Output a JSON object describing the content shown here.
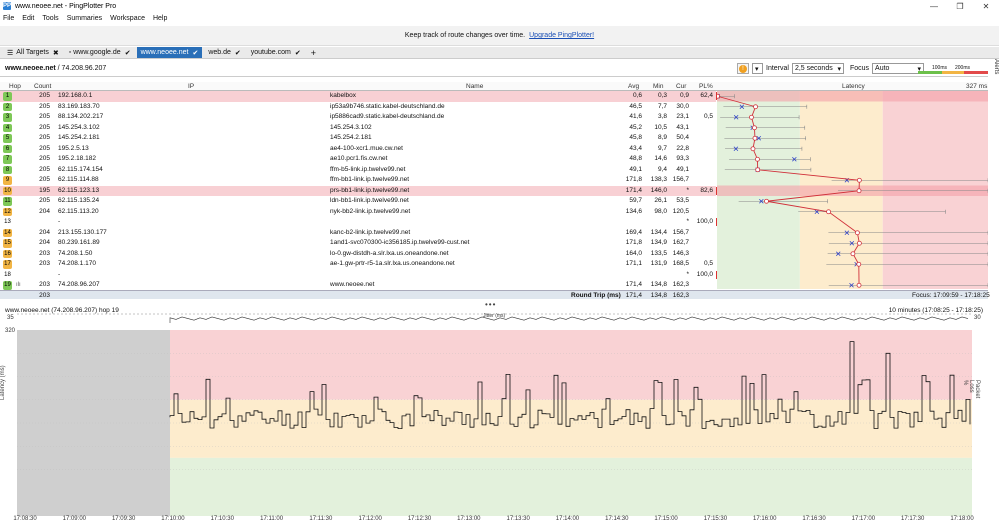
{
  "window": {
    "title": "www.neoee.net - PingPlotter Pro",
    "app_icon": "PP"
  },
  "menu": [
    "File",
    "Edit",
    "Tools",
    "Summaries",
    "Workspace",
    "Help"
  ],
  "promo": {
    "text": "Keep track of route changes over time.",
    "link": "Upgrade PingPlotter!"
  },
  "tabs": [
    {
      "label": "All Targets",
      "active": false,
      "mark": "✖"
    },
    {
      "label": "www.google.de",
      "active": false,
      "mark": "✔"
    },
    {
      "label": "www.neoee.net",
      "active": true,
      "mark": "✔"
    },
    {
      "label": "web.de",
      "active": false,
      "mark": "✔"
    },
    {
      "label": "youtube.com",
      "active": false,
      "mark": "✔"
    }
  ],
  "add_tab": "+",
  "target": {
    "host": "www.neoee.net",
    "ip": "/ 74.208.96.207"
  },
  "controls": {
    "interval_label": "Interval",
    "interval_value": "2,5 seconds",
    "focus_label": "Focus",
    "focus_value": "Auto"
  },
  "scale": {
    "low": "100ms",
    "high": "200ms"
  },
  "alerts_label": "Alerts",
  "grid_headers": {
    "hop": "Hop",
    "count": "Count",
    "ip": "IP",
    "name": "Name",
    "avg": "Avg",
    "min": "Min",
    "cur": "Cur",
    "pl": "PL%",
    "latency": "Latency",
    "max": "327 ms"
  },
  "hops": [
    {
      "hop": "1",
      "count": "205",
      "ip": "192.168.0.1",
      "name": "kabelbox",
      "avg": "0,6",
      "min": "0,3",
      "cur": "0,9",
      "pl": "62,4",
      "color": "#7ec857",
      "hl": true
    },
    {
      "hop": "2",
      "count": "205",
      "ip": "83.169.183.70",
      "name": "ip53a9b746.static.kabel-deutschland.de",
      "avg": "46,5",
      "min": "7,7",
      "cur": "30,0",
      "pl": "",
      "color": "#7ec857",
      "hl": false
    },
    {
      "hop": "3",
      "count": "205",
      "ip": "88.134.202.217",
      "name": "ip5886cad9.static.kabel-deutschland.de",
      "avg": "41,6",
      "min": "3,8",
      "cur": "23,1",
      "pl": "0,5",
      "color": "#7ec857",
      "hl": false
    },
    {
      "hop": "4",
      "count": "205",
      "ip": "145.254.3.102",
      "name": "145.254.3.102",
      "avg": "45,2",
      "min": "10,5",
      "cur": "43,1",
      "pl": "",
      "color": "#7ec857",
      "hl": false
    },
    {
      "hop": "5",
      "count": "205",
      "ip": "145.254.2.181",
      "name": "145.254.2.181",
      "avg": "45,8",
      "min": "8,9",
      "cur": "50,4",
      "pl": "",
      "color": "#7ec857",
      "hl": false
    },
    {
      "hop": "6",
      "count": "205",
      "ip": "195.2.5.13",
      "name": "ae4-100-xcr1.mue.cw.net",
      "avg": "43,4",
      "min": "9,7",
      "cur": "22,8",
      "pl": "",
      "color": "#7ec857",
      "hl": false
    },
    {
      "hop": "7",
      "count": "205",
      "ip": "195.2.18.182",
      "name": "ae10.pcr1.fis.cw.net",
      "avg": "48,8",
      "min": "14,6",
      "cur": "93,3",
      "pl": "",
      "color": "#7ec857",
      "hl": false
    },
    {
      "hop": "8",
      "count": "205",
      "ip": "62.115.174.154",
      "name": "ffm-b5-link.ip.twelve99.net",
      "avg": "49,1",
      "min": "9,4",
      "cur": "49,1",
      "pl": "",
      "color": "#7ec857",
      "hl": false
    },
    {
      "hop": "9",
      "count": "205",
      "ip": "62.115.114.88",
      "name": "ffm-bb1-link.ip.twelve99.net",
      "avg": "171,8",
      "min": "138,3",
      "cur": "156,7",
      "pl": "",
      "color": "#f2b544",
      "hl": false
    },
    {
      "hop": "10",
      "count": "195",
      "ip": "62.115.123.13",
      "name": "prs-bb1-link.ip.twelve99.net",
      "avg": "171,4",
      "min": "146,0",
      "cur": "*",
      "pl": "82,6",
      "color": "#f2b544",
      "hl": true
    },
    {
      "hop": "11",
      "count": "205",
      "ip": "62.115.135.24",
      "name": "ldn-bb1-link.ip.twelve99.net",
      "avg": "59,7",
      "min": "26,1",
      "cur": "53,5",
      "pl": "",
      "color": "#7ec857",
      "hl": false
    },
    {
      "hop": "12",
      "count": "204",
      "ip": "62.115.113.20",
      "name": "nyk-bb2-link.ip.twelve99.net",
      "avg": "134,6",
      "min": "98,0",
      "cur": "120,5",
      "pl": "",
      "color": "#f2b544",
      "hl": false
    },
    {
      "hop": "13",
      "count": "",
      "ip": "-",
      "name": "",
      "avg": "",
      "min": "",
      "cur": "*",
      "pl": "100,0",
      "color": "",
      "hl": false
    },
    {
      "hop": "14",
      "count": "204",
      "ip": "213.155.130.177",
      "name": "kanc-b2-link.ip.twelve99.net",
      "avg": "169,4",
      "min": "134,4",
      "cur": "156,7",
      "pl": "",
      "color": "#f2b544",
      "hl": false
    },
    {
      "hop": "15",
      "count": "204",
      "ip": "80.239.161.89",
      "name": "1and1-svc070300-ic356185.ip.twelve99-cust.net",
      "avg": "171,8",
      "min": "134,9",
      "cur": "162,7",
      "pl": "",
      "color": "#f2b544",
      "hl": false
    },
    {
      "hop": "16",
      "count": "203",
      "ip": "74.208.1.50",
      "name": "lo-0.gw-distdh-a.slr.lxa.us.oneandone.net",
      "avg": "164,0",
      "min": "133,5",
      "cur": "146,3",
      "pl": "",
      "color": "#f2b544",
      "hl": false
    },
    {
      "hop": "17",
      "count": "203",
      "ip": "74.208.1.170",
      "name": "ae-1.gw-prtr-r5-1a.slr.lxa.us.oneandone.net",
      "avg": "171,1",
      "min": "131,9",
      "cur": "168,5",
      "pl": "0,5",
      "color": "#f2b544",
      "hl": false
    },
    {
      "hop": "18",
      "count": "",
      "ip": "-",
      "name": "",
      "avg": "",
      "min": "",
      "cur": "*",
      "pl": "100,0",
      "color": "",
      "hl": false
    },
    {
      "hop": "19",
      "count": "203",
      "ip": "74.208.96.207",
      "name": "www.neoee.net",
      "avg": "171,4",
      "min": "134,8",
      "cur": "162,3",
      "pl": "",
      "color": "#7ec857",
      "hl": false
    }
  ],
  "footer": {
    "count": "203",
    "label": "Round Trip (ms)",
    "avg": "171,4",
    "min": "134,8",
    "cur": "162,3",
    "focus": "Focus: 17:09:59 - 17:18:25"
  },
  "graph": {
    "title": "www.neoee.net (74.208.96.207) hop 19",
    "range": "10 minutes (17:08:25 - 17:18:25)",
    "jitter_label": "Jitter (ms)",
    "jitter_max": "35",
    "jitter_right": "30",
    "latency_max": "320",
    "y_label": "Latency (ms)",
    "y_right_label": "Packet Loss %",
    "x_ticks": [
      "17:08:30",
      "17:09:00",
      "17:09:30",
      "17:10:00",
      "17:10:30",
      "17:11:00",
      "17:11:30",
      "17:12:00",
      "17:12:30",
      "17:13:00",
      "17:13:30",
      "17:14:00",
      "17:14:30",
      "17:15:00",
      "17:15:30",
      "17:16:00",
      "17:16:30",
      "17:17:00",
      "17:17:30",
      "17:18:00"
    ]
  }
}
